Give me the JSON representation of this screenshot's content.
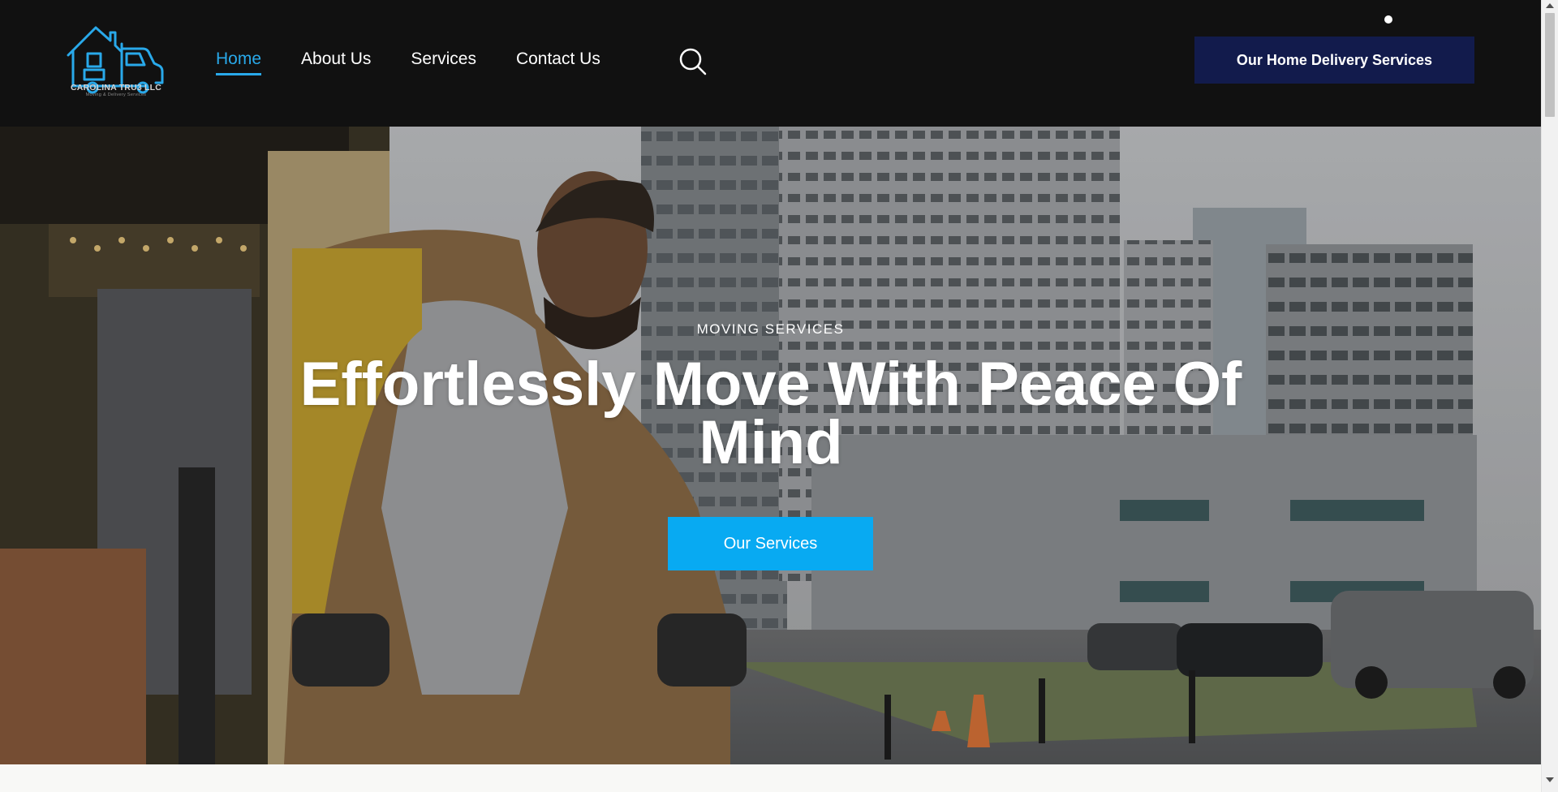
{
  "brand": {
    "name": "CAROLINA TRU3 LLC",
    "tagline": "Moving & Delivery Services",
    "color": "#29a9ea"
  },
  "nav": {
    "items": [
      {
        "label": "Home",
        "active": true
      },
      {
        "label": "About Us",
        "active": false
      },
      {
        "label": "Services",
        "active": false
      },
      {
        "label": "Contact Us",
        "active": false
      }
    ],
    "search_icon": "search-icon"
  },
  "header_cta": {
    "label": "Our Home Delivery Services",
    "color": "#121b4c"
  },
  "hero": {
    "subtitle": "MOVING SERVICES",
    "title": "Effortlessly Move With Peace Of Mind",
    "button": {
      "label": "Our Services",
      "color": "#08aaf2"
    }
  },
  "colors": {
    "header_bg": "#111111",
    "accent": "#29a9ea"
  }
}
